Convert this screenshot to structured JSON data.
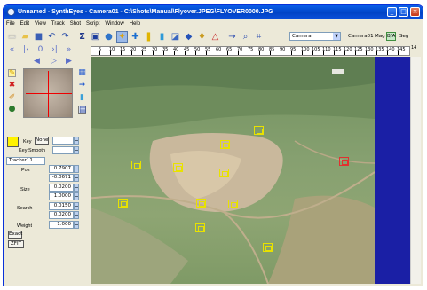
{
  "window": {
    "title": "Unnamed - SynthEyes - Camera01 - C:\\Shots\\Manual\\Flyover.JPEG\\FLYOVER0000.JPG"
  },
  "menu": [
    "File",
    "Edit",
    "View",
    "Track",
    "Shot",
    "Script",
    "Window",
    "Help"
  ],
  "toolbar": {
    "camera_select": "Camera",
    "camera_label": "Camera01",
    "mag_label": "Mag",
    "ba_label": "B/A",
    "seg_label": "Seg"
  },
  "timeline": {
    "ticks": [
      "5",
      "10",
      "15",
      "20",
      "25",
      "30",
      "35",
      "40",
      "45",
      "50",
      "55",
      "60",
      "65",
      "70",
      "75",
      "80",
      "85",
      "90",
      "95",
      "100",
      "105",
      "110",
      "115",
      "120",
      "125",
      "130",
      "135",
      "140",
      "145"
    ],
    "current_frame": "0",
    "end_label": "14"
  },
  "tracker_panel": {
    "key_label": "Key",
    "key_value": "None",
    "key_smooth_label": "Key Smooth",
    "key_smooth_value": "",
    "tracker_name": "Tracker11",
    "pos_label": "Pos",
    "pos_x": "0.7907",
    "pos_y": "-0.0671",
    "size_label": "Size",
    "size_x": "0.0200",
    "size_y": "1.0000",
    "search_label": "Search",
    "search_x": "0.0150",
    "search_y": "0.0200",
    "weight_label": "Weight",
    "weight_value": "1.000",
    "exact_button": "Exact",
    "zfit_button": "ZFIT"
  },
  "colors": {
    "titlebar": "#0043c6",
    "tracker_marker": "#e8e200",
    "selected_tracker": "#e23030",
    "key_swatch": "#fff200",
    "blue_margin": "#1a1fa5"
  }
}
